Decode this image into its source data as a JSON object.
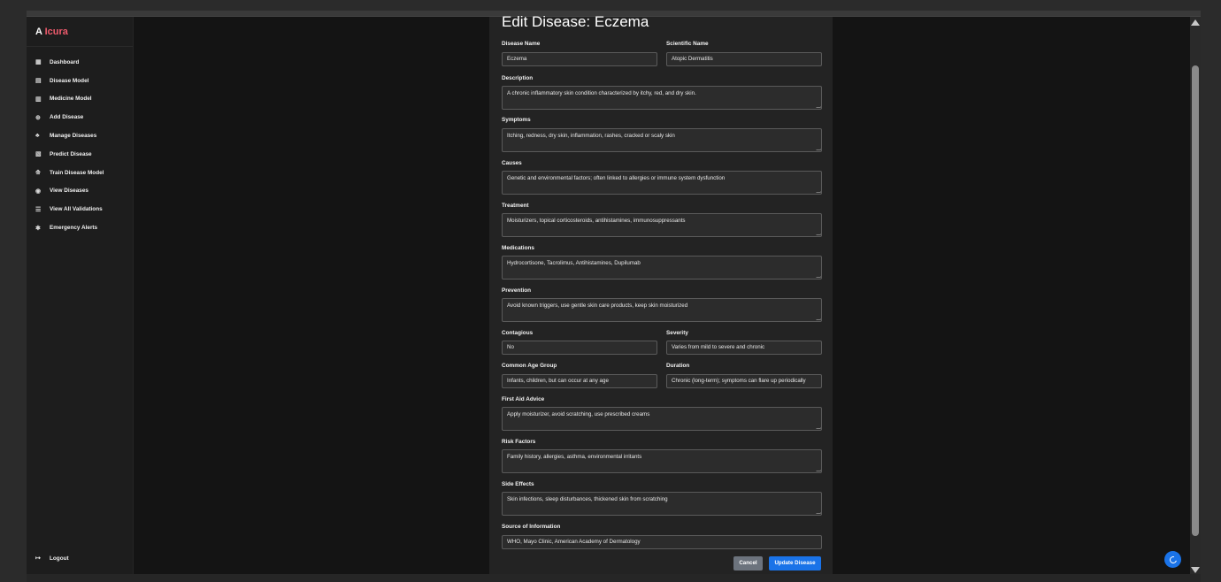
{
  "brand": {
    "prefix": "A",
    "name": "Icura",
    "accent_color": "#ef5b6d"
  },
  "sidebar": {
    "items": [
      {
        "icon": "dashboard-icon",
        "glyph": "▦",
        "label": "Dashboard"
      },
      {
        "icon": "disease-model-icon",
        "glyph": "▤",
        "label": "Disease Model"
      },
      {
        "icon": "medicine-model-icon",
        "glyph": "▥",
        "label": "Medicine Model"
      },
      {
        "icon": "add-circle-icon",
        "glyph": "⊕",
        "label": "Add Disease"
      },
      {
        "icon": "manage-users-icon",
        "glyph": "♣",
        "label": "Manage Diseases"
      },
      {
        "icon": "predict-icon",
        "glyph": "▧",
        "label": "Predict Disease"
      },
      {
        "icon": "train-model-icon",
        "glyph": "⟰",
        "label": "Train Disease Model"
      },
      {
        "icon": "eye-icon",
        "glyph": "◉",
        "label": "View Diseases"
      },
      {
        "icon": "list-check-icon",
        "glyph": "☰",
        "label": "View All Validations"
      },
      {
        "icon": "asterisk-icon",
        "glyph": "✱",
        "label": "Emergency Alerts"
      }
    ],
    "logout": {
      "icon": "logout-icon",
      "glyph": "↦",
      "label": "Logout"
    }
  },
  "form": {
    "title": "Edit Disease: Eczema",
    "disease_name": {
      "label": "Disease Name",
      "value": "Eczema"
    },
    "scientific_name": {
      "label": "Scientific Name",
      "value": "Atopic Dermatitis"
    },
    "description": {
      "label": "Description",
      "value": "A chronic inflammatory skin condition characterized by itchy, red, and dry skin."
    },
    "symptoms": {
      "label": "Symptoms",
      "value": "Itching, redness, dry skin, inflammation, rashes, cracked or scaly skin"
    },
    "causes": {
      "label": "Causes",
      "value": "Genetic and environmental factors; often linked to allergies or immune system dysfunction"
    },
    "treatment": {
      "label": "Treatment",
      "value": "Moisturizers, topical corticosteroids, antihistamines, immunosuppressants"
    },
    "medications": {
      "label": "Medications",
      "value": "Hydrocortisone, Tacrolimus, Antihistamines, Dupilumab"
    },
    "prevention": {
      "label": "Prevention",
      "value": "Avoid known triggers, use gentle skin care products, keep skin moisturized"
    },
    "contagious": {
      "label": "Contagious",
      "value": "No"
    },
    "severity": {
      "label": "Severity",
      "value": "Varies from mild to severe and chronic"
    },
    "common_age_group": {
      "label": "Common Age Group",
      "value": "Infants, children, but can occur at any age"
    },
    "duration": {
      "label": "Duration",
      "value": "Chronic (long-term); symptoms can flare up periodically"
    },
    "first_aid_advice": {
      "label": "First Aid Advice",
      "value": "Apply moisturizer, avoid scratching, use prescribed creams"
    },
    "risk_factors": {
      "label": "Risk Factors",
      "value": "Family history, allergies, asthma, environmental irritants"
    },
    "side_effects": {
      "label": "Side Effects",
      "value": "Skin infections, sleep disturbances, thickened skin from scratching"
    },
    "source_of_information": {
      "label": "Source of Information",
      "value": "WHO, Mayo Clinic, American Academy of Dermatology"
    },
    "cancel_label": "Cancel",
    "update_label": "Update Disease"
  },
  "colors": {
    "primary": "#1a73e8",
    "cancel": "#6c737d",
    "panel": "#232323",
    "background": "#141414"
  },
  "theme_toggle": {
    "icon": "moon-icon"
  }
}
